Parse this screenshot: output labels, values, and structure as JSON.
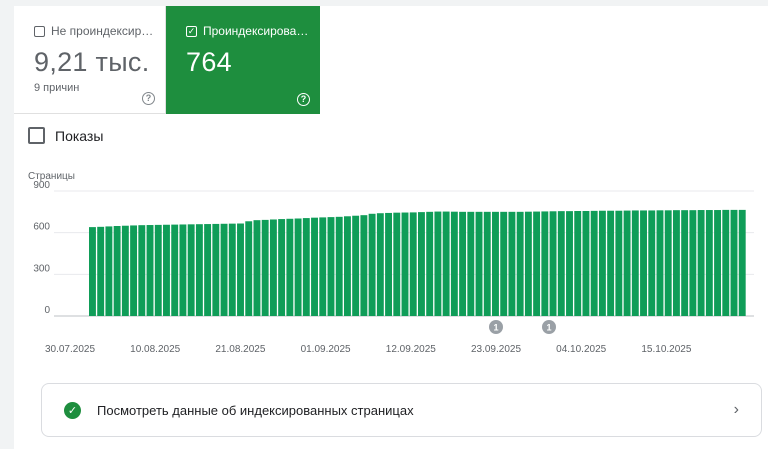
{
  "tiles": {
    "not_indexed": {
      "label": "Не проиндексир…",
      "value": "9,21 тыс.",
      "subtitle": "9 причин",
      "checked": false
    },
    "indexed": {
      "label": "Проиндексирова…",
      "value": "764",
      "checked": true
    }
  },
  "impressions_toggle": {
    "label": "Показы",
    "checked": false
  },
  "chart_data": {
    "type": "bar",
    "ylabel": "Страницы",
    "ylim": [
      0,
      900
    ],
    "yticks": [
      0,
      300,
      600,
      900
    ],
    "series": [
      {
        "color": "#0f9d58",
        "values": [
          640,
          642,
          645,
          648,
          650,
          652,
          654,
          655,
          656,
          657,
          658,
          659,
          660,
          661,
          662,
          663,
          664,
          665,
          666,
          682,
          690,
          692,
          695,
          698,
          700,
          702,
          705,
          708,
          710,
          712,
          714,
          718,
          722,
          726,
          736,
          740,
          742,
          744,
          745,
          746,
          748,
          750,
          752,
          752,
          751,
          750,
          750,
          750,
          750,
          750,
          750,
          750,
          750,
          751,
          752,
          753,
          754,
          755,
          755,
          756,
          756,
          757,
          758,
          758,
          758,
          759,
          760,
          760,
          760,
          761,
          761,
          762,
          762,
          762,
          763,
          763,
          763,
          764,
          764,
          764
        ]
      }
    ],
    "x_tick_labels": [
      "30.07.2025",
      "10.08.2025",
      "21.08.2025",
      "01.09.2025",
      "12.09.2025",
      "23.09.2025",
      "04.10.2025",
      "15.10.2025"
    ],
    "annotations": [
      {
        "label": "1"
      },
      {
        "label": "1"
      }
    ]
  },
  "details_row": {
    "label": "Посмотреть данные об индексированных страницах"
  },
  "colors": {
    "accent": "#1e8e3e",
    "bar": "#0f9d58"
  },
  "icons": {
    "check": "check-icon",
    "help": "help-icon",
    "chevron": "chevron-right-icon"
  }
}
